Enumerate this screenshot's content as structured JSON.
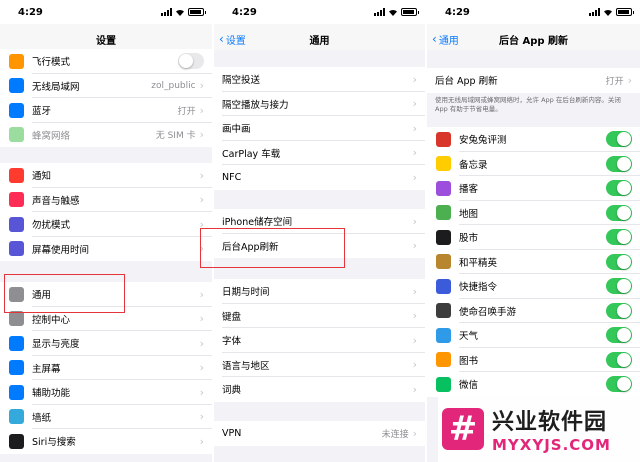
{
  "status": {
    "time": "4:29"
  },
  "screen1": {
    "title": "设置",
    "groups": [
      {
        "rows": [
          {
            "label": "飞行模式",
            "icon": "airplane-icon",
            "color": "#ff9500",
            "toggle": false
          },
          {
            "label": "无线局域网",
            "value": "zol_public",
            "icon": "wifi-icon",
            "color": "#007aff"
          },
          {
            "label": "蓝牙",
            "value": "打开",
            "icon": "bluetooth-icon",
            "color": "#007aff"
          },
          {
            "label": "蜂窝网络",
            "value": "无 SIM 卡",
            "icon": "cellular-icon",
            "color": "#9bdc9f",
            "dim": true
          }
        ]
      },
      {
        "rows": [
          {
            "label": "通知",
            "icon": "notification-icon",
            "color": "#ff3b30"
          },
          {
            "label": "声音与触感",
            "icon": "sound-icon",
            "color": "#ff2d55"
          },
          {
            "label": "勿扰模式",
            "icon": "moon-icon",
            "color": "#5856d6"
          },
          {
            "label": "屏幕使用时间",
            "icon": "hourglass-icon",
            "color": "#5856d6"
          }
        ]
      },
      {
        "rows": [
          {
            "label": "通用",
            "icon": "gear-icon",
            "color": "#8e8e93"
          },
          {
            "label": "控制中心",
            "icon": "control-center-icon",
            "color": "#8e8e93"
          },
          {
            "label": "显示与亮度",
            "icon": "brightness-icon",
            "color": "#007aff"
          },
          {
            "label": "主屏幕",
            "icon": "home-screen-icon",
            "color": "#007aff"
          },
          {
            "label": "辅助功能",
            "icon": "accessibility-icon",
            "color": "#007aff"
          },
          {
            "label": "墙纸",
            "icon": "wallpaper-icon",
            "color": "#34aadc"
          },
          {
            "label": "Siri与搜索",
            "icon": "siri-icon",
            "color": "#1c1c1e"
          }
        ]
      }
    ]
  },
  "screen2": {
    "back": "设置",
    "title": "通用",
    "groups": [
      {
        "rows": [
          {
            "label": "隔空投送"
          },
          {
            "label": "隔空播放与接力"
          },
          {
            "label": "画中画"
          },
          {
            "label": "CarPlay 车载"
          },
          {
            "label": "NFC"
          }
        ]
      },
      {
        "rows": [
          {
            "label": "iPhone储存空间"
          },
          {
            "label": "后台App刷新"
          }
        ]
      },
      {
        "rows": [
          {
            "label": "日期与时间"
          },
          {
            "label": "键盘"
          },
          {
            "label": "字体"
          },
          {
            "label": "语言与地区"
          },
          {
            "label": "词典"
          }
        ]
      },
      {
        "rows": [
          {
            "label": "VPN",
            "value": "未连接"
          }
        ]
      }
    ]
  },
  "screen3": {
    "back": "通用",
    "title": "后台 App 刷新",
    "setting": {
      "label": "后台 App 刷新",
      "value": "打开"
    },
    "note": "使用无线局域网或蜂窝网络时，允许 App 在后台刷新内容。关闭 App 有助于节省电量。",
    "apps": [
      {
        "label": "安兔兔评测",
        "icon": "antutu-icon",
        "color": "#d9362b",
        "on": true
      },
      {
        "label": "备忘录",
        "icon": "notes-icon",
        "color": "#ffcc00",
        "on": true
      },
      {
        "label": "播客",
        "icon": "podcast-icon",
        "color": "#9b4fdc",
        "on": true
      },
      {
        "label": "地图",
        "icon": "maps-icon",
        "color": "#4cb050",
        "on": true
      },
      {
        "label": "股市",
        "icon": "stocks-icon",
        "color": "#1c1c1e",
        "on": true
      },
      {
        "label": "和平精英",
        "icon": "game-icon",
        "color": "#b8862f",
        "on": true
      },
      {
        "label": "快捷指令",
        "icon": "shortcuts-icon",
        "color": "#3b5bdb",
        "on": true
      },
      {
        "label": "使命召唤手游",
        "icon": "cod-icon",
        "color": "#3d3d3d",
        "on": true
      },
      {
        "label": "天气",
        "icon": "weather-icon",
        "color": "#2f9be8",
        "on": true
      },
      {
        "label": "图书",
        "icon": "books-icon",
        "color": "#ff9500",
        "on": true
      },
      {
        "label": "微信",
        "icon": "wechat-icon",
        "color": "#07c160",
        "on": true
      }
    ]
  },
  "watermark": {
    "cn": "兴业软件园",
    "en": "MYXYJS.COM",
    "logo": "#"
  }
}
